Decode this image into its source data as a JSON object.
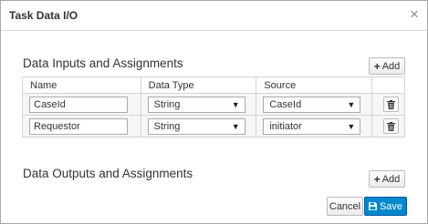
{
  "dialog": {
    "title": "Task Data I/O",
    "close_glyph": "×"
  },
  "inputs": {
    "section_title": "Data Inputs and Assignments",
    "add_label": "Add",
    "columns": [
      "Name",
      "Data Type",
      "Source"
    ],
    "rows": [
      {
        "name": "CaseId",
        "data_type": "String",
        "source": "CaseId"
      },
      {
        "name": "Requestor",
        "data_type": "String",
        "source": "initiator"
      }
    ]
  },
  "outputs": {
    "section_title": "Data Outputs and Assignments",
    "add_label": "Add"
  },
  "footer": {
    "cancel_label": "Cancel",
    "save_label": "Save"
  },
  "icons": {
    "close": "close-icon",
    "add": "plus-icon",
    "delete": "trash-icon",
    "dropdown": "caret-down-icon",
    "save": "floppy-disk-icon"
  },
  "colors": {
    "primary": "#0088ce",
    "border": "#a9a9a9",
    "row_background": "#f6f6f6"
  }
}
